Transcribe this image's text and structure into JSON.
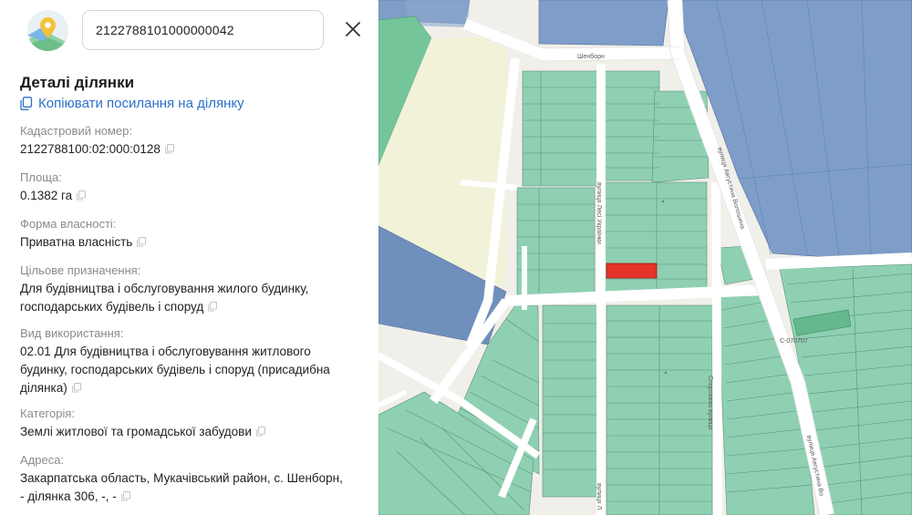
{
  "search": {
    "value": "2122788101000000042"
  },
  "panel": {
    "title": "Деталі ділянки",
    "copy_link": "Копіювати посилання на ділянку"
  },
  "fields": {
    "cadastral": {
      "label": "Кадастровий номер:",
      "value": "2122788100:02:000:0128"
    },
    "area": {
      "label": "Площа:",
      "value": "0.1382 га"
    },
    "ownership": {
      "label": "Форма власності:",
      "value": "Приватна власність"
    },
    "purpose": {
      "label": "Цільове призначення:",
      "line1": "Для будівництва і обслуговування жилого будинку,",
      "line2": "господарських будівель і споруд"
    },
    "usage": {
      "label": "Вид використання:",
      "line1": "02.01 Для будівництва і обслуговування житлового",
      "line2": "будинку, господарських будівель і споруд (присадибна",
      "line3": "ділянка)"
    },
    "category": {
      "label": "Категорія:",
      "value": "Землі житлової та громадської забудови"
    },
    "address": {
      "label": "Адреса:",
      "line1": "Закарпатська область, Мукачівський район, с. Шенборн,",
      "line2": "- ділянка 306, -, -"
    }
  },
  "map": {
    "street_labels": {
      "top": "Шенборн",
      "lesi": "вулиця Лесі Українки",
      "avgustyna_upper": "вулиця Августина Волошина",
      "avgustyna_lower": "вулиця Августина Во",
      "sportyvna": "Спортивна вулиця",
      "bottom": "вулиця Л",
      "code": "С-070707"
    },
    "colors": {
      "parcel": "#8fd0b3",
      "parcel_stroke": "#5a8f7a",
      "selected_parcel": "#e5332a",
      "blue_zone": "#7e9dc8",
      "green_zone": "#74c59a",
      "road": "#ffffff",
      "accent_link": "#2d6fca"
    }
  }
}
